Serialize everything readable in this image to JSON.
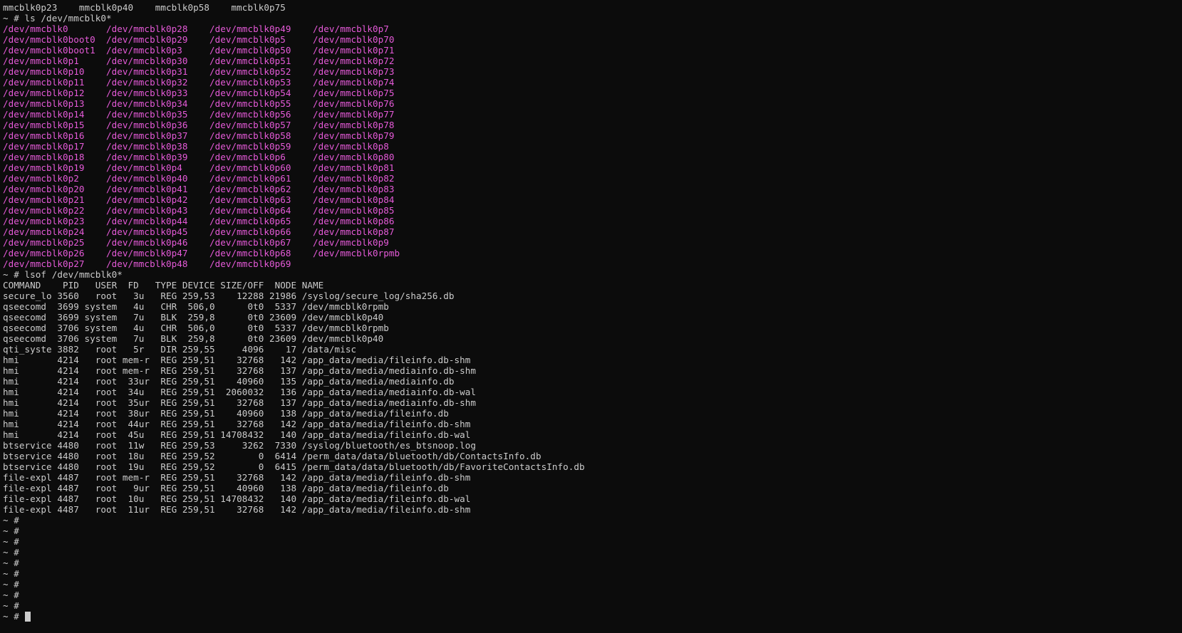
{
  "terminal": {
    "colors": {
      "background": "#0c0c0c",
      "text": "#cccccc",
      "device_path": "#e55ad8"
    },
    "lines": [
      {
        "type": "plain",
        "text": "mmcblk0p23    mmcblk0p40    mmcblk0p58    mmcblk0p75"
      },
      {
        "type": "plain",
        "text": "~ # ls /dev/mmcblk0*"
      },
      {
        "type": "dev",
        "text": "/dev/mmcblk0       /dev/mmcblk0p28    /dev/mmcblk0p49    /dev/mmcblk0p7"
      },
      {
        "type": "dev",
        "text": "/dev/mmcblk0boot0  /dev/mmcblk0p29    /dev/mmcblk0p5     /dev/mmcblk0p70"
      },
      {
        "type": "dev",
        "text": "/dev/mmcblk0boot1  /dev/mmcblk0p3     /dev/mmcblk0p50    /dev/mmcblk0p71"
      },
      {
        "type": "dev",
        "text": "/dev/mmcblk0p1     /dev/mmcblk0p30    /dev/mmcblk0p51    /dev/mmcblk0p72"
      },
      {
        "type": "dev",
        "text": "/dev/mmcblk0p10    /dev/mmcblk0p31    /dev/mmcblk0p52    /dev/mmcblk0p73"
      },
      {
        "type": "dev",
        "text": "/dev/mmcblk0p11    /dev/mmcblk0p32    /dev/mmcblk0p53    /dev/mmcblk0p74"
      },
      {
        "type": "dev",
        "text": "/dev/mmcblk0p12    /dev/mmcblk0p33    /dev/mmcblk0p54    /dev/mmcblk0p75"
      },
      {
        "type": "dev",
        "text": "/dev/mmcblk0p13    /dev/mmcblk0p34    /dev/mmcblk0p55    /dev/mmcblk0p76"
      },
      {
        "type": "dev",
        "text": "/dev/mmcblk0p14    /dev/mmcblk0p35    /dev/mmcblk0p56    /dev/mmcblk0p77"
      },
      {
        "type": "dev",
        "text": "/dev/mmcblk0p15    /dev/mmcblk0p36    /dev/mmcblk0p57    /dev/mmcblk0p78"
      },
      {
        "type": "dev",
        "text": "/dev/mmcblk0p16    /dev/mmcblk0p37    /dev/mmcblk0p58    /dev/mmcblk0p79"
      },
      {
        "type": "dev",
        "text": "/dev/mmcblk0p17    /dev/mmcblk0p38    /dev/mmcblk0p59    /dev/mmcblk0p8"
      },
      {
        "type": "dev",
        "text": "/dev/mmcblk0p18    /dev/mmcblk0p39    /dev/mmcblk0p6     /dev/mmcblk0p80"
      },
      {
        "type": "dev",
        "text": "/dev/mmcblk0p19    /dev/mmcblk0p4     /dev/mmcblk0p60    /dev/mmcblk0p81"
      },
      {
        "type": "dev",
        "text": "/dev/mmcblk0p2     /dev/mmcblk0p40    /dev/mmcblk0p61    /dev/mmcblk0p82"
      },
      {
        "type": "dev",
        "text": "/dev/mmcblk0p20    /dev/mmcblk0p41    /dev/mmcblk0p62    /dev/mmcblk0p83"
      },
      {
        "type": "dev",
        "text": "/dev/mmcblk0p21    /dev/mmcblk0p42    /dev/mmcblk0p63    /dev/mmcblk0p84"
      },
      {
        "type": "dev",
        "text": "/dev/mmcblk0p22    /dev/mmcblk0p43    /dev/mmcblk0p64    /dev/mmcblk0p85"
      },
      {
        "type": "dev",
        "text": "/dev/mmcblk0p23    /dev/mmcblk0p44    /dev/mmcblk0p65    /dev/mmcblk0p86"
      },
      {
        "type": "dev",
        "text": "/dev/mmcblk0p24    /dev/mmcblk0p45    /dev/mmcblk0p66    /dev/mmcblk0p87"
      },
      {
        "type": "dev",
        "text": "/dev/mmcblk0p25    /dev/mmcblk0p46    /dev/mmcblk0p67    /dev/mmcblk0p9"
      },
      {
        "type": "dev",
        "text": "/dev/mmcblk0p26    /dev/mmcblk0p47    /dev/mmcblk0p68    /dev/mmcblk0rpmb"
      },
      {
        "type": "dev",
        "text": "/dev/mmcblk0p27    /dev/mmcblk0p48    /dev/mmcblk0p69"
      },
      {
        "type": "plain",
        "text": "~ # lsof /dev/mmcblk0*"
      },
      {
        "type": "plain",
        "text": "COMMAND    PID   USER  FD   TYPE DEVICE SIZE/OFF  NODE NAME"
      },
      {
        "type": "plain",
        "text": "secure_lo 3560   root   3u   REG 259,53    12288 21986 /syslog/secure_log/sha256.db"
      },
      {
        "type": "plain",
        "text": "qseecomd  3699 system   4u   CHR  506,0      0t0  5337 /dev/mmcblk0rpmb"
      },
      {
        "type": "plain",
        "text": "qseecomd  3699 system   7u   BLK  259,8      0t0 23609 /dev/mmcblk0p40"
      },
      {
        "type": "plain",
        "text": "qseecomd  3706 system   4u   CHR  506,0      0t0  5337 /dev/mmcblk0rpmb"
      },
      {
        "type": "plain",
        "text": "qseecomd  3706 system   7u   BLK  259,8      0t0 23609 /dev/mmcblk0p40"
      },
      {
        "type": "plain",
        "text": "qti_syste 3882   root   5r   DIR 259,55     4096    17 /data/misc"
      },
      {
        "type": "plain",
        "text": "hmi       4214   root mem-r  REG 259,51    32768   142 /app_data/media/fileinfo.db-shm"
      },
      {
        "type": "plain",
        "text": "hmi       4214   root mem-r  REG 259,51    32768   137 /app_data/media/mediainfo.db-shm"
      },
      {
        "type": "plain",
        "text": "hmi       4214   root  33ur  REG 259,51    40960   135 /app_data/media/mediainfo.db"
      },
      {
        "type": "plain",
        "text": "hmi       4214   root  34u   REG 259,51  2060032   136 /app_data/media/mediainfo.db-wal"
      },
      {
        "type": "plain",
        "text": "hmi       4214   root  35ur  REG 259,51    32768   137 /app_data/media/mediainfo.db-shm"
      },
      {
        "type": "plain",
        "text": "hmi       4214   root  38ur  REG 259,51    40960   138 /app_data/media/fileinfo.db"
      },
      {
        "type": "plain",
        "text": "hmi       4214   root  44ur  REG 259,51    32768   142 /app_data/media/fileinfo.db-shm"
      },
      {
        "type": "plain",
        "text": "hmi       4214   root  45u   REG 259,51 14708432   140 /app_data/media/fileinfo.db-wal"
      },
      {
        "type": "plain",
        "text": "btservice 4480   root  11w   REG 259,53     3262  7330 /syslog/bluetooth/es_btsnoop.log"
      },
      {
        "type": "plain",
        "text": "btservice 4480   root  18u   REG 259,52        0  6414 /perm_data/data/bluetooth/db/ContactsInfo.db"
      },
      {
        "type": "plain",
        "text": "btservice 4480   root  19u   REG 259,52        0  6415 /perm_data/data/bluetooth/db/FavoriteContactsInfo.db"
      },
      {
        "type": "plain",
        "text": "file-expl 4487   root mem-r  REG 259,51    32768   142 /app_data/media/fileinfo.db-shm"
      },
      {
        "type": "plain",
        "text": "file-expl 4487   root   9ur  REG 259,51    40960   138 /app_data/media/fileinfo.db"
      },
      {
        "type": "plain",
        "text": "file-expl 4487   root  10u   REG 259,51 14708432   140 /app_data/media/fileinfo.db-wal"
      },
      {
        "type": "plain",
        "text": "file-expl 4487   root  11ur  REG 259,51    32768   142 /app_data/media/fileinfo.db-shm"
      },
      {
        "type": "plain",
        "text": "~ #"
      },
      {
        "type": "plain",
        "text": "~ #"
      },
      {
        "type": "plain",
        "text": "~ #"
      },
      {
        "type": "plain",
        "text": "~ #"
      },
      {
        "type": "plain",
        "text": "~ #"
      },
      {
        "type": "plain",
        "text": "~ #"
      },
      {
        "type": "plain",
        "text": "~ #"
      },
      {
        "type": "plain",
        "text": "~ #"
      },
      {
        "type": "plain",
        "text": "~ #"
      }
    ],
    "prompt": "~ # "
  }
}
